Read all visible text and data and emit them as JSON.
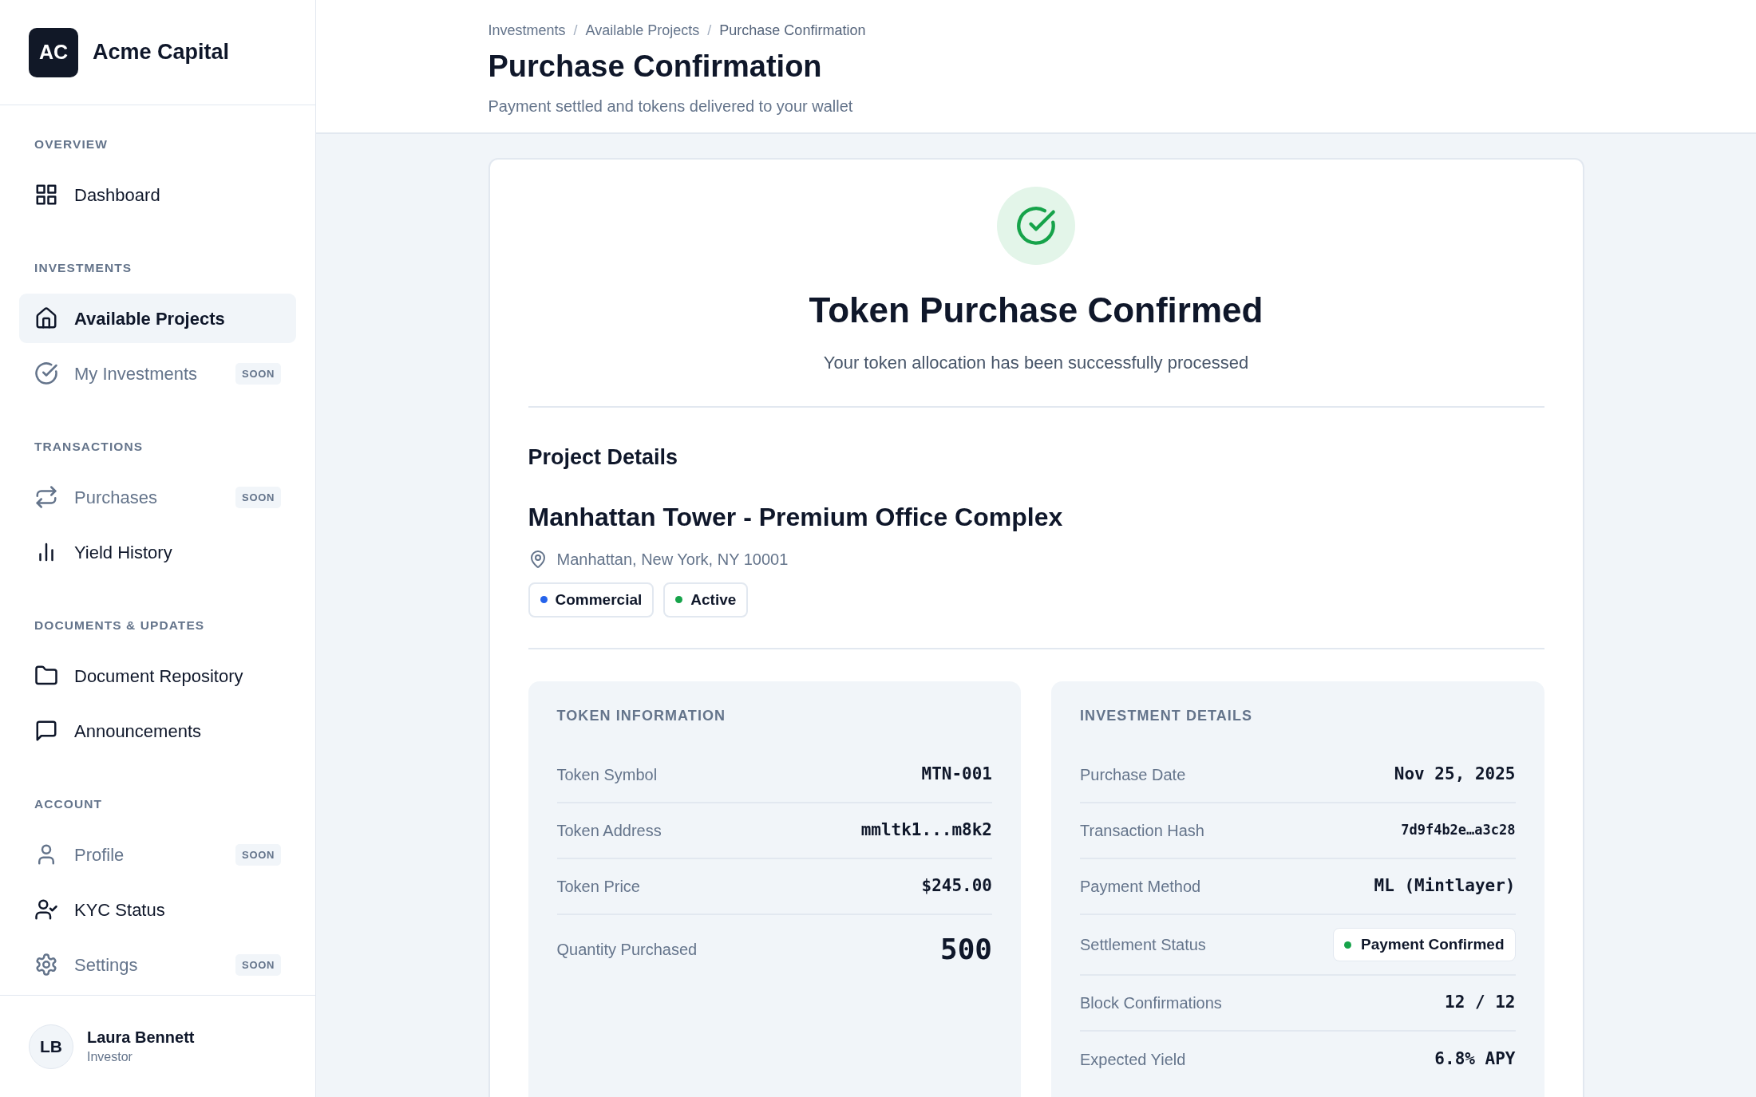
{
  "brand": {
    "initials": "AC",
    "name": "Acme Capital"
  },
  "nav_sections": [
    {
      "title": "OVERVIEW",
      "items": [
        {
          "label": "Dashboard",
          "selected": false,
          "disabled": false
        }
      ]
    },
    {
      "title": "INVESTMENTS",
      "items": [
        {
          "label": "Available Projects",
          "selected": true,
          "disabled": false
        },
        {
          "label": "My Investments",
          "selected": false,
          "disabled": true,
          "badge": "SOON"
        }
      ]
    },
    {
      "title": "TRANSACTIONS",
      "items": [
        {
          "label": "Purchases",
          "selected": false,
          "disabled": true,
          "badge": "SOON"
        },
        {
          "label": "Yield History",
          "selected": false,
          "disabled": false
        }
      ]
    },
    {
      "title": "DOCUMENTS & UPDATES",
      "items": [
        {
          "label": "Document Repository",
          "selected": false,
          "disabled": false
        },
        {
          "label": "Announcements",
          "selected": false,
          "disabled": false
        }
      ]
    },
    {
      "title": "ACCOUNT",
      "items": [
        {
          "label": "Profile",
          "selected": false,
          "disabled": true,
          "badge": "SOON"
        },
        {
          "label": "KYC Status",
          "selected": false,
          "disabled": false
        },
        {
          "label": "Settings",
          "selected": false,
          "disabled": true,
          "badge": "SOON"
        }
      ]
    }
  ],
  "user": {
    "initials": "LB",
    "name": "Laura Bennett",
    "role": "Investor"
  },
  "header": {
    "breadcrumb": [
      {
        "label": "Investments",
        "kind": "link"
      },
      {
        "label": "/",
        "kind": "separator"
      },
      {
        "label": "Available Projects",
        "kind": "link"
      },
      {
        "label": "/",
        "kind": "separator"
      },
      {
        "label": "Purchase Confirmation",
        "kind": "current"
      }
    ],
    "title": "Purchase Confirmation",
    "subtitle": "Payment settled and tokens delivered to your wallet"
  },
  "confirmation": {
    "title": "Token Purchase Confirmed",
    "message": "Your token allocation has been successfully processed"
  },
  "project": {
    "section_title": "Project Details",
    "name": "Manhattan Tower - Premium Office Complex",
    "location": "Manhattan, New York, NY 10001",
    "tags": [
      {
        "label": "Commercial",
        "color": "#2563eb"
      },
      {
        "label": "Active",
        "color": "#16a34a"
      }
    ]
  },
  "panels": [
    {
      "title": "TOKEN INFORMATION",
      "rows": [
        {
          "label": "Token Symbol",
          "value": "MTN-001",
          "kind": "mono"
        },
        {
          "label": "Token Address",
          "value": "mmltk1...m8k2",
          "kind": "mono"
        },
        {
          "label": "Token Price",
          "value": "$245.00",
          "kind": "mono"
        },
        {
          "label": "Quantity Purchased",
          "value": "500",
          "kind": "large"
        }
      ]
    },
    {
      "title": "INVESTMENT DETAILS",
      "rows": [
        {
          "label": "Purchase Date",
          "value": "Nov 25, 2025",
          "kind": "mono"
        },
        {
          "label": "Transaction Hash",
          "value": "7d9f4b2e…a3c28",
          "kind": "hash"
        },
        {
          "label": "Payment Method",
          "value": "ML (Mintlayer)",
          "kind": "mono"
        },
        {
          "label": "Settlement Status",
          "value": "Payment Confirmed",
          "kind": "status",
          "color": "#16a34a"
        },
        {
          "label": "Block Confirmations",
          "value": "12 / 12",
          "kind": "mono"
        },
        {
          "label": "Expected Yield",
          "value": "6.8% APY",
          "kind": "mono"
        }
      ]
    }
  ]
}
